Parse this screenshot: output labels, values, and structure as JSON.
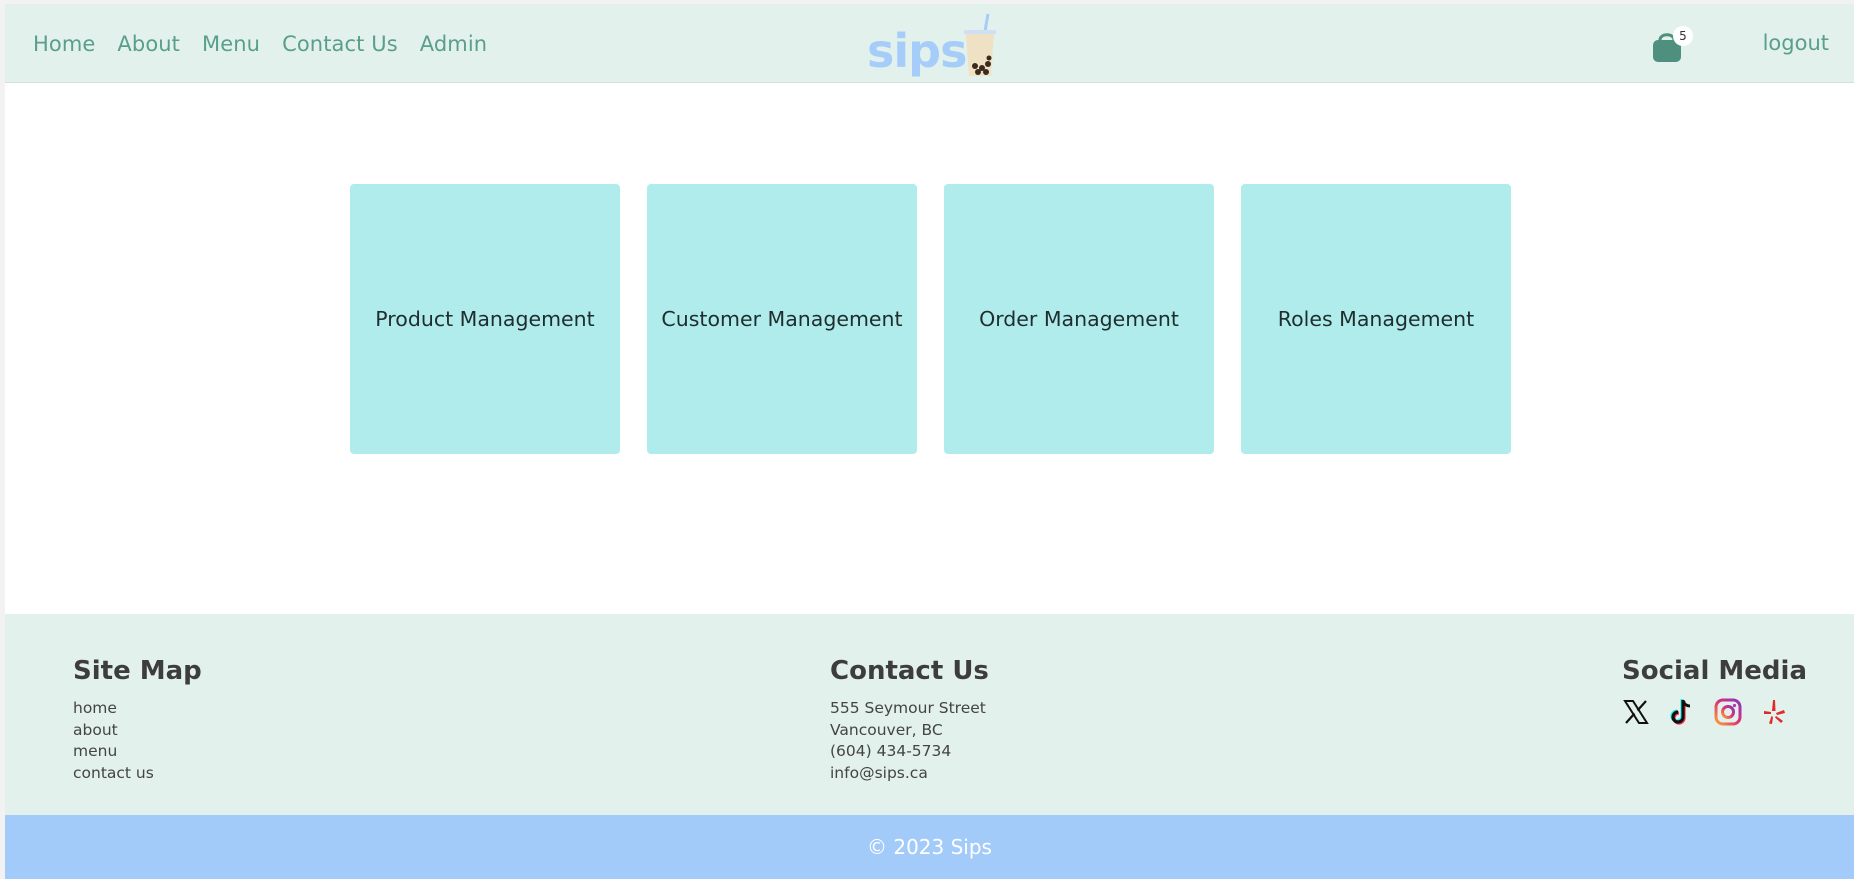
{
  "header": {
    "nav": [
      "Home",
      "About",
      "Menu",
      "Contact Us",
      "Admin"
    ],
    "logo_text": "sips",
    "cart_count": "5",
    "logout_label": "logout"
  },
  "cards": [
    "Product Management",
    "Customer Management",
    "Order Management",
    "Roles Management"
  ],
  "footer": {
    "sitemap": {
      "title": "Site Map",
      "links": [
        "home",
        "about",
        "menu",
        "contact us"
      ]
    },
    "contact": {
      "title": "Contact Us",
      "street": "555 Seymour Street",
      "city": "Vancouver, BC",
      "phone": "(604) 434-5734",
      "email": "info@sips.ca"
    },
    "social": {
      "title": "Social Media",
      "icons": [
        "x-icon",
        "tiktok-icon",
        "instagram-icon",
        "yelp-icon"
      ]
    },
    "copyright": "© 2023 Sips"
  },
  "colors": {
    "header_bg": "#e2f1ec",
    "nav_text": "#5a9e8c",
    "card_bg": "#b0ecec",
    "copyright_bar": "#a2cbfa",
    "logo": "#a6cdf9"
  }
}
